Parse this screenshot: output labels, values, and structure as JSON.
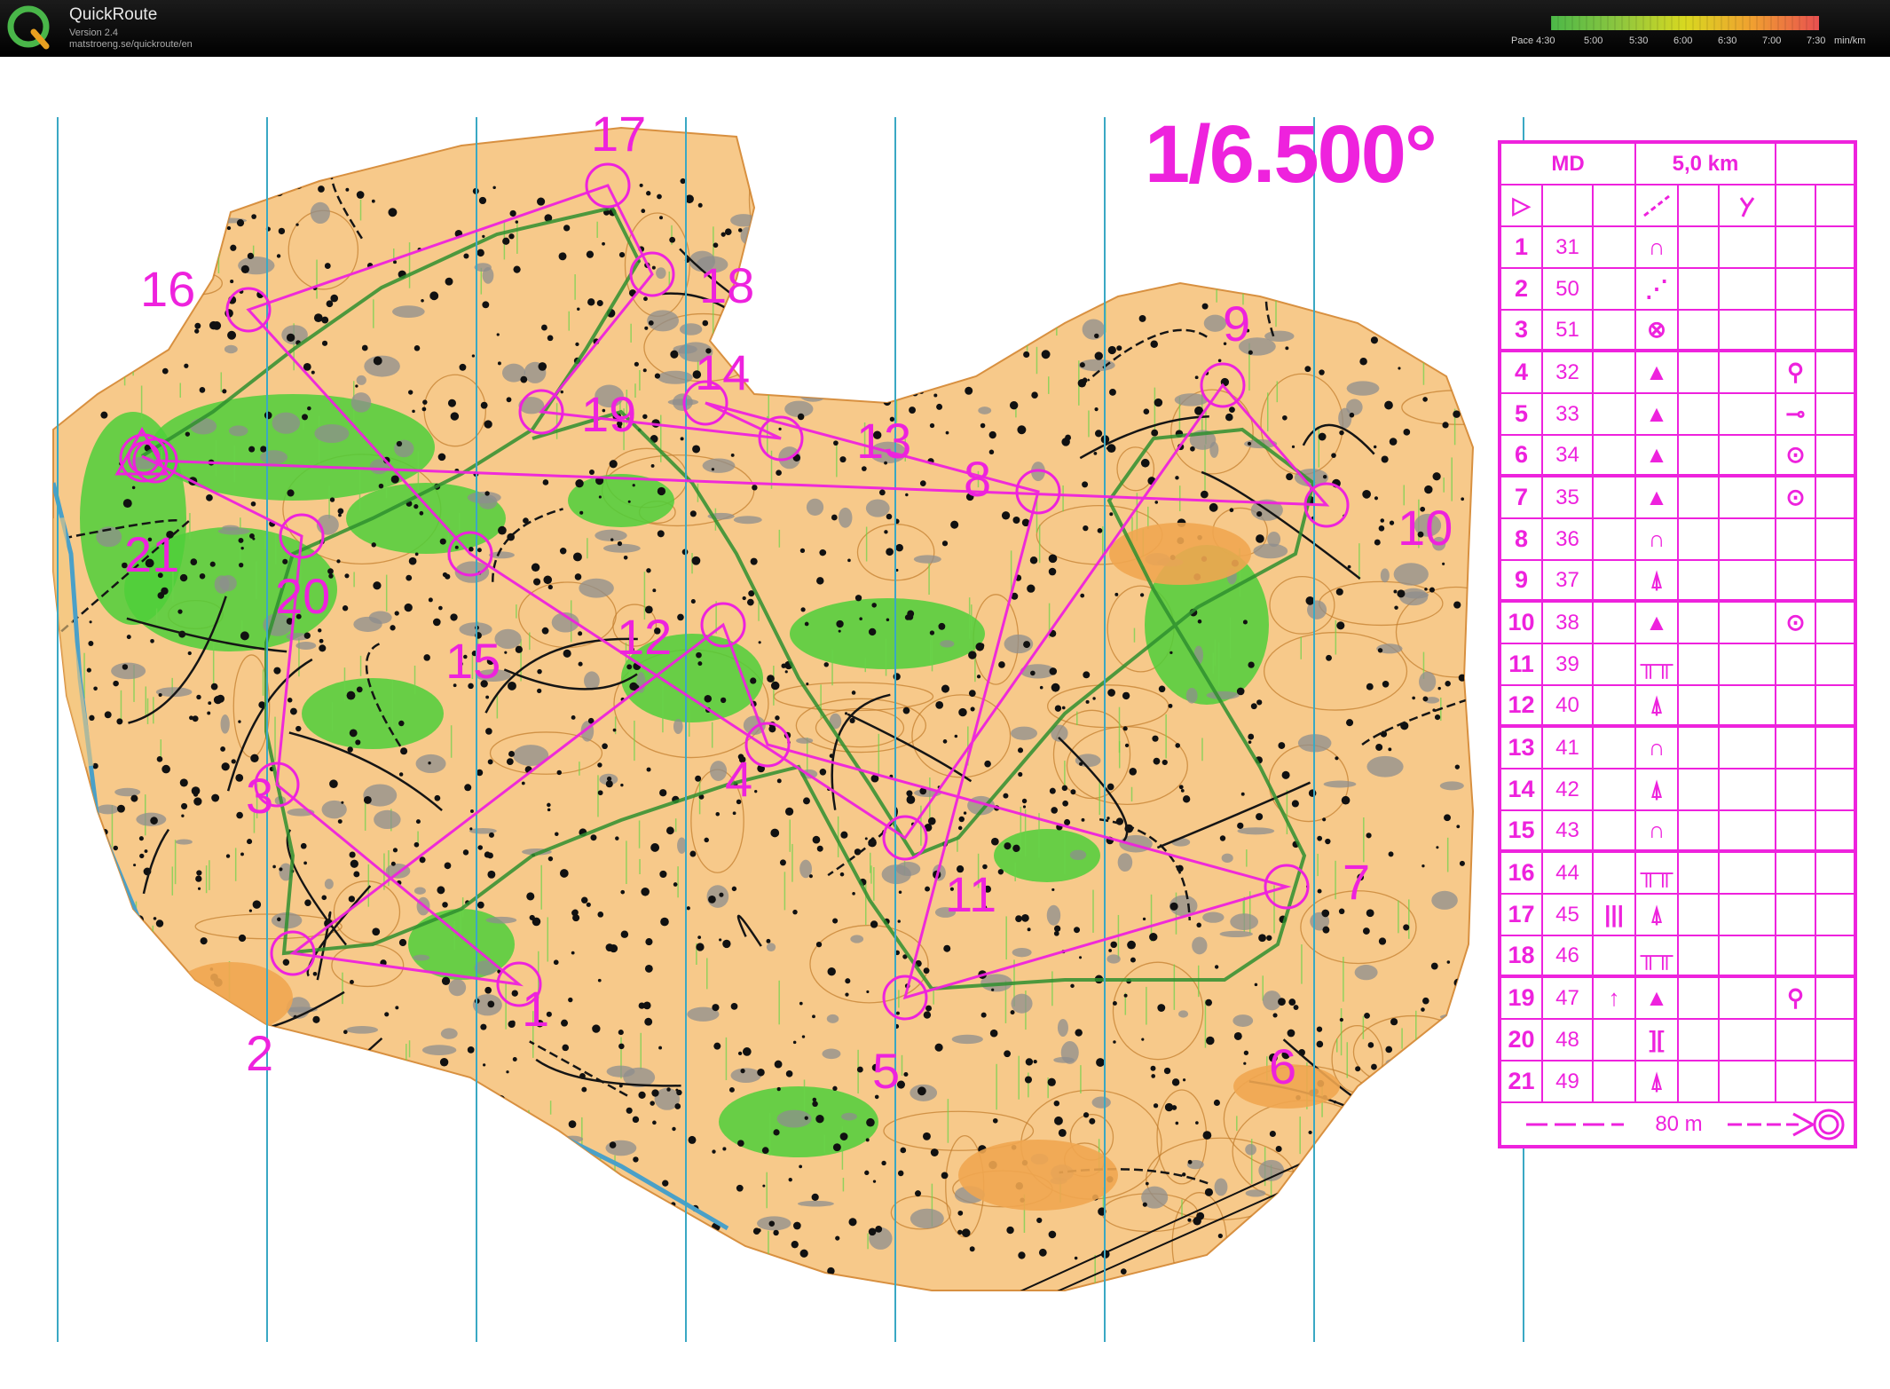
{
  "app": {
    "title": "QuickRoute",
    "version": "Version 2.4",
    "url": "matstroeng.se/quickroute/en"
  },
  "pace_legend": {
    "labels": [
      "Pace 4:30",
      "5:00",
      "5:30",
      "6:00",
      "6:30",
      "7:00",
      "7:30"
    ],
    "unit": "min/km",
    "colors": [
      "#4cb848",
      "#8cc63f",
      "#d8d820",
      "#f0a030",
      "#e85050"
    ]
  },
  "map": {
    "scale": "1/6.500°",
    "colors": {
      "open_land": "#f7c98a",
      "forest_green": "#4fcf3a",
      "course_magenta": "#ee22dd",
      "north_line": "#3aa8c4",
      "water": "#4aa0c8"
    },
    "control_labels": [
      "1",
      "2",
      "3",
      "4",
      "5",
      "6",
      "7",
      "8",
      "9",
      "10",
      "11",
      "12",
      "13",
      "14",
      "15",
      "16",
      "17",
      "18",
      "19",
      "20",
      "21"
    ]
  },
  "description_sheet": {
    "class": "MD",
    "length": "5,0 km",
    "start_symbol": "▷",
    "finish_text": "80 m",
    "controls": [
      {
        "num": "1",
        "code": "31",
        "sym": "∩",
        "extra": "",
        "where": ""
      },
      {
        "num": "2",
        "code": "50",
        "sym": "⋰",
        "extra": "",
        "where": ""
      },
      {
        "num": "3",
        "code": "51",
        "sym": "⊗",
        "extra": "",
        "where": ""
      },
      {
        "num": "4",
        "code": "32",
        "sym": "▲",
        "extra": "",
        "where": "⚲"
      },
      {
        "num": "5",
        "code": "33",
        "sym": "▲",
        "extra": "",
        "where": "⊸"
      },
      {
        "num": "6",
        "code": "34",
        "sym": "▲",
        "extra": "",
        "where": "⊙"
      },
      {
        "num": "7",
        "code": "35",
        "sym": "▲",
        "extra": "",
        "where": "⊙"
      },
      {
        "num": "8",
        "code": "36",
        "sym": "∩",
        "extra": "",
        "where": ""
      },
      {
        "num": "9",
        "code": "37",
        "sym": "⍋",
        "extra": "",
        "where": ""
      },
      {
        "num": "10",
        "code": "38",
        "sym": "▲",
        "extra": "",
        "where": "⊙"
      },
      {
        "num": "11",
        "code": "39",
        "sym": "╥╥",
        "extra": "",
        "where": ""
      },
      {
        "num": "12",
        "code": "40",
        "sym": "⍋",
        "extra": "",
        "where": ""
      },
      {
        "num": "13",
        "code": "41",
        "sym": "∩",
        "extra": "",
        "where": ""
      },
      {
        "num": "14",
        "code": "42",
        "sym": "⍋",
        "extra": "",
        "where": ""
      },
      {
        "num": "15",
        "code": "43",
        "sym": "∩",
        "extra": "",
        "where": ""
      },
      {
        "num": "16",
        "code": "44",
        "sym": "╥╥",
        "extra": "",
        "where": ""
      },
      {
        "num": "17",
        "code": "45",
        "sym": "⍋",
        "extra": "|||",
        "where": ""
      },
      {
        "num": "18",
        "code": "46",
        "sym": "╥╥",
        "extra": "",
        "where": ""
      },
      {
        "num": "19",
        "code": "47",
        "sym": "▲",
        "extra": "↑",
        "where": "⚲"
      },
      {
        "num": "20",
        "code": "48",
        "sym": "][",
        "extra": "",
        "where": ""
      },
      {
        "num": "21",
        "code": "49",
        "sym": "⍋",
        "extra": "",
        "where": ""
      }
    ]
  }
}
